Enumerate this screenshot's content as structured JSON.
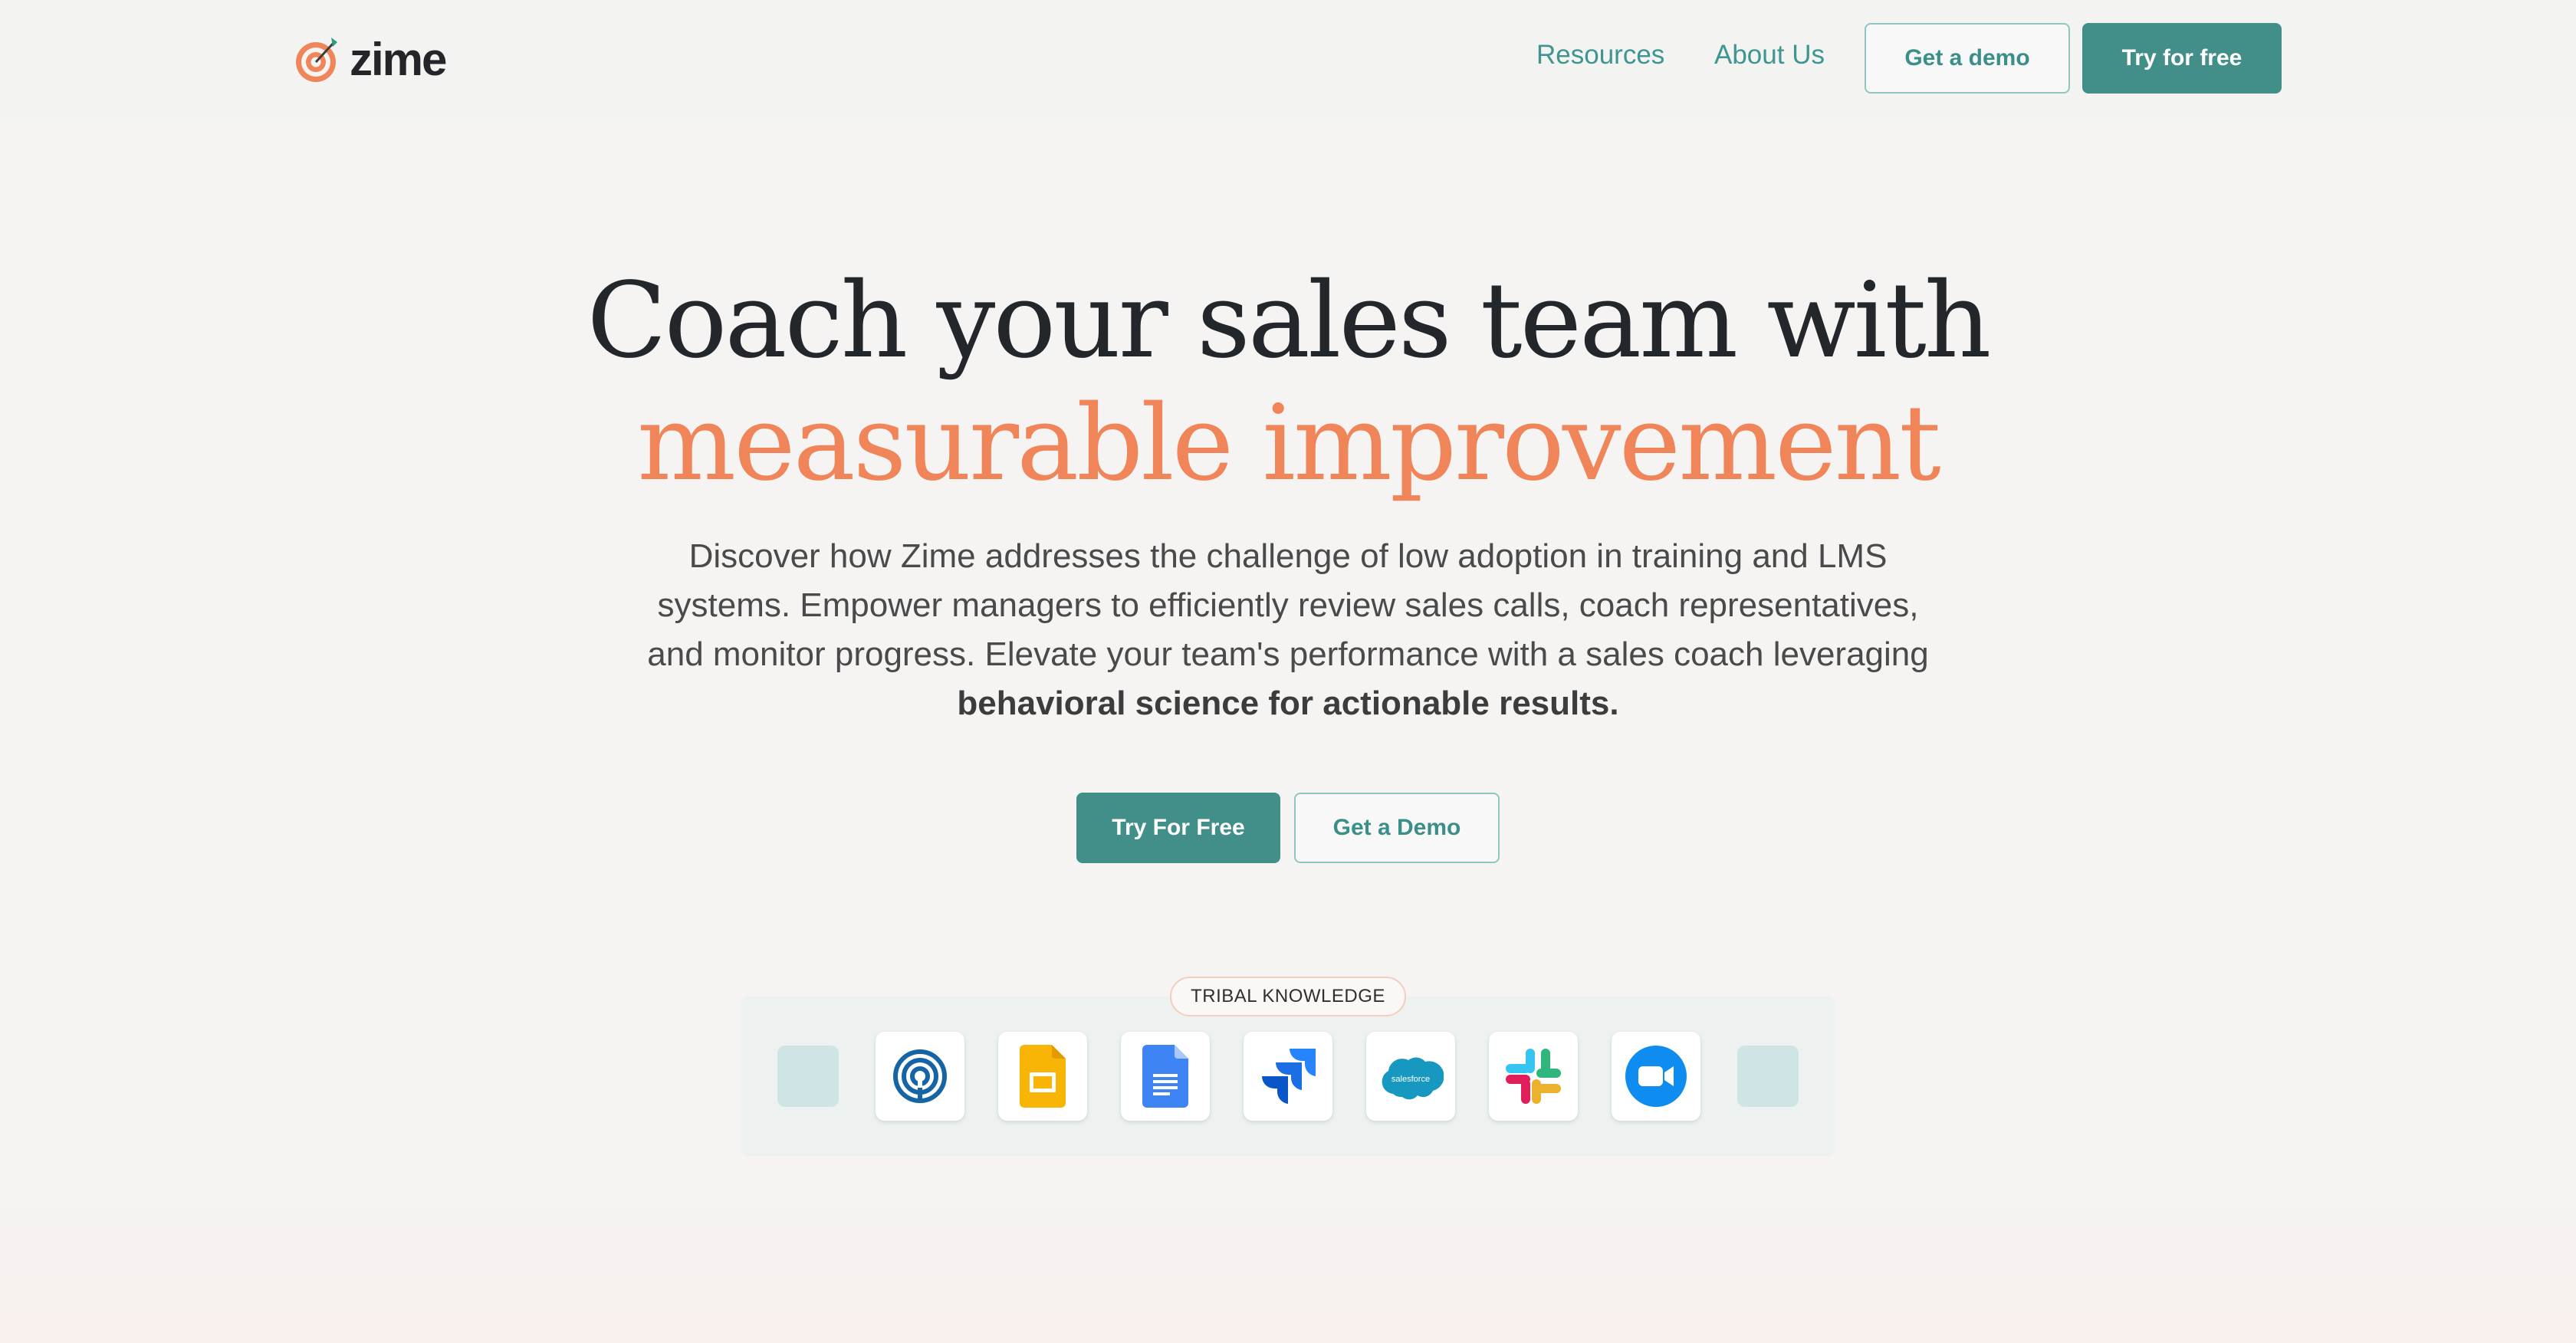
{
  "brand": {
    "name": "zime",
    "accent": "#428f89",
    "highlight": "#f0855a"
  },
  "nav": {
    "resources": "Resources",
    "about": "About Us",
    "demo_button": "Get a demo",
    "try_button": "Try for free"
  },
  "hero": {
    "line1": "Coach your sales team with",
    "line2": "measurable improvement",
    "description_plain": "Discover how Zime addresses the challenge of low adoption in training and LMS systems. Empower managers to efficiently review sales calls, coach representatives, and monitor progress. Elevate your team's performance with a sales coach leveraging ",
    "description_bold": "behavioral science for actionable results.",
    "try_button": "Try For Free",
    "demo_button": "Get a Demo"
  },
  "integrations": {
    "badge": "TRIBAL KNOWLEDGE",
    "icons": [
      "spiral-app-icon",
      "google-slides-icon",
      "google-docs-icon",
      "jira-icon",
      "salesforce-icon",
      "slack-icon",
      "zoom-icon"
    ],
    "salesforce_text": "salesforce"
  }
}
